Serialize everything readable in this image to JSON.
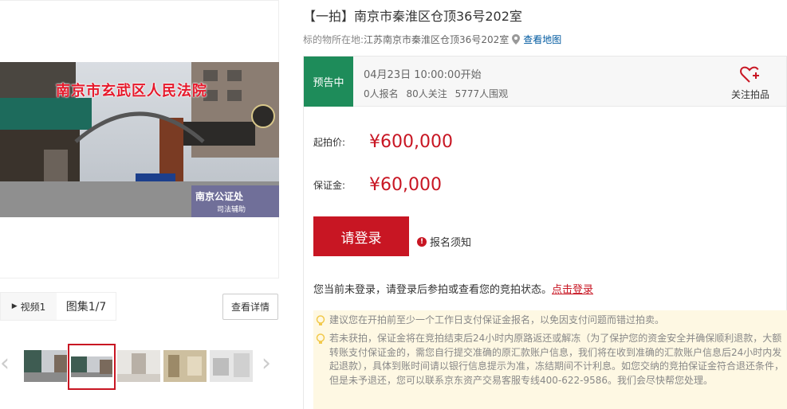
{
  "gallery": {
    "photo_caption": "南京市玄武区人民法院",
    "tab_video": "视频1",
    "tab_album": "图集1/7",
    "detail_button": "查看详情",
    "thumbnail_count": 5,
    "active_thumbnail": 2
  },
  "lot": {
    "title": "【一拍】南京市秦淮区仓顶36号202室",
    "location_label": "标的物所在地:",
    "location_address": "江苏南京市秦淮区仓顶36号202室",
    "map_link": "查看地图"
  },
  "status": {
    "tag": "预告中",
    "start_time": "04月23日 10:00:00开始",
    "registered": "0人报名",
    "followers": "80人关注",
    "onlookers": "5777人围观",
    "follow_label": "关注拍品"
  },
  "pricing": {
    "start_label": "起拍价:",
    "start_value": "¥600,000",
    "deposit_label": "保证金:",
    "deposit_value": "¥60,000"
  },
  "actions": {
    "login_button": "请登录",
    "notice_label": "报名须知",
    "login_message": "您当前未登录，请登录后参拍或查看您的竞拍状态。",
    "login_link": "点击登录"
  },
  "tips": [
    "建议您在开拍前至少一个工作日支付保证金报名，以免因支付问题而错过拍卖。",
    "若未获拍，保证金将在竞拍结束后24小时内原路返还或解冻（为了保护您的资金安全并确保顺利退款，大额转账支付保证金的，需您自行提交准确的原汇款账户信息，我们将在收到准确的汇款账户信息后24小时内发起退款），具体到账时间请以银行信息提示为准，冻结期间不计利息。如您交纳的竞拍保证金符合退还条件，但是未予退还，您可以联系京东资产交易客服专线400-622-9586。我们会尽快帮您处理。"
  ],
  "colors": {
    "brand_red": "#c81623",
    "status_green": "#1e8c5a",
    "tip_bg": "#fef8e3",
    "link_blue": "#005aa0"
  },
  "icons": [
    "play-icon",
    "chevron-left-icon",
    "chevron-right-icon",
    "location-pin-icon",
    "heart-plus-icon",
    "info-icon",
    "lightbulb-icon"
  ]
}
